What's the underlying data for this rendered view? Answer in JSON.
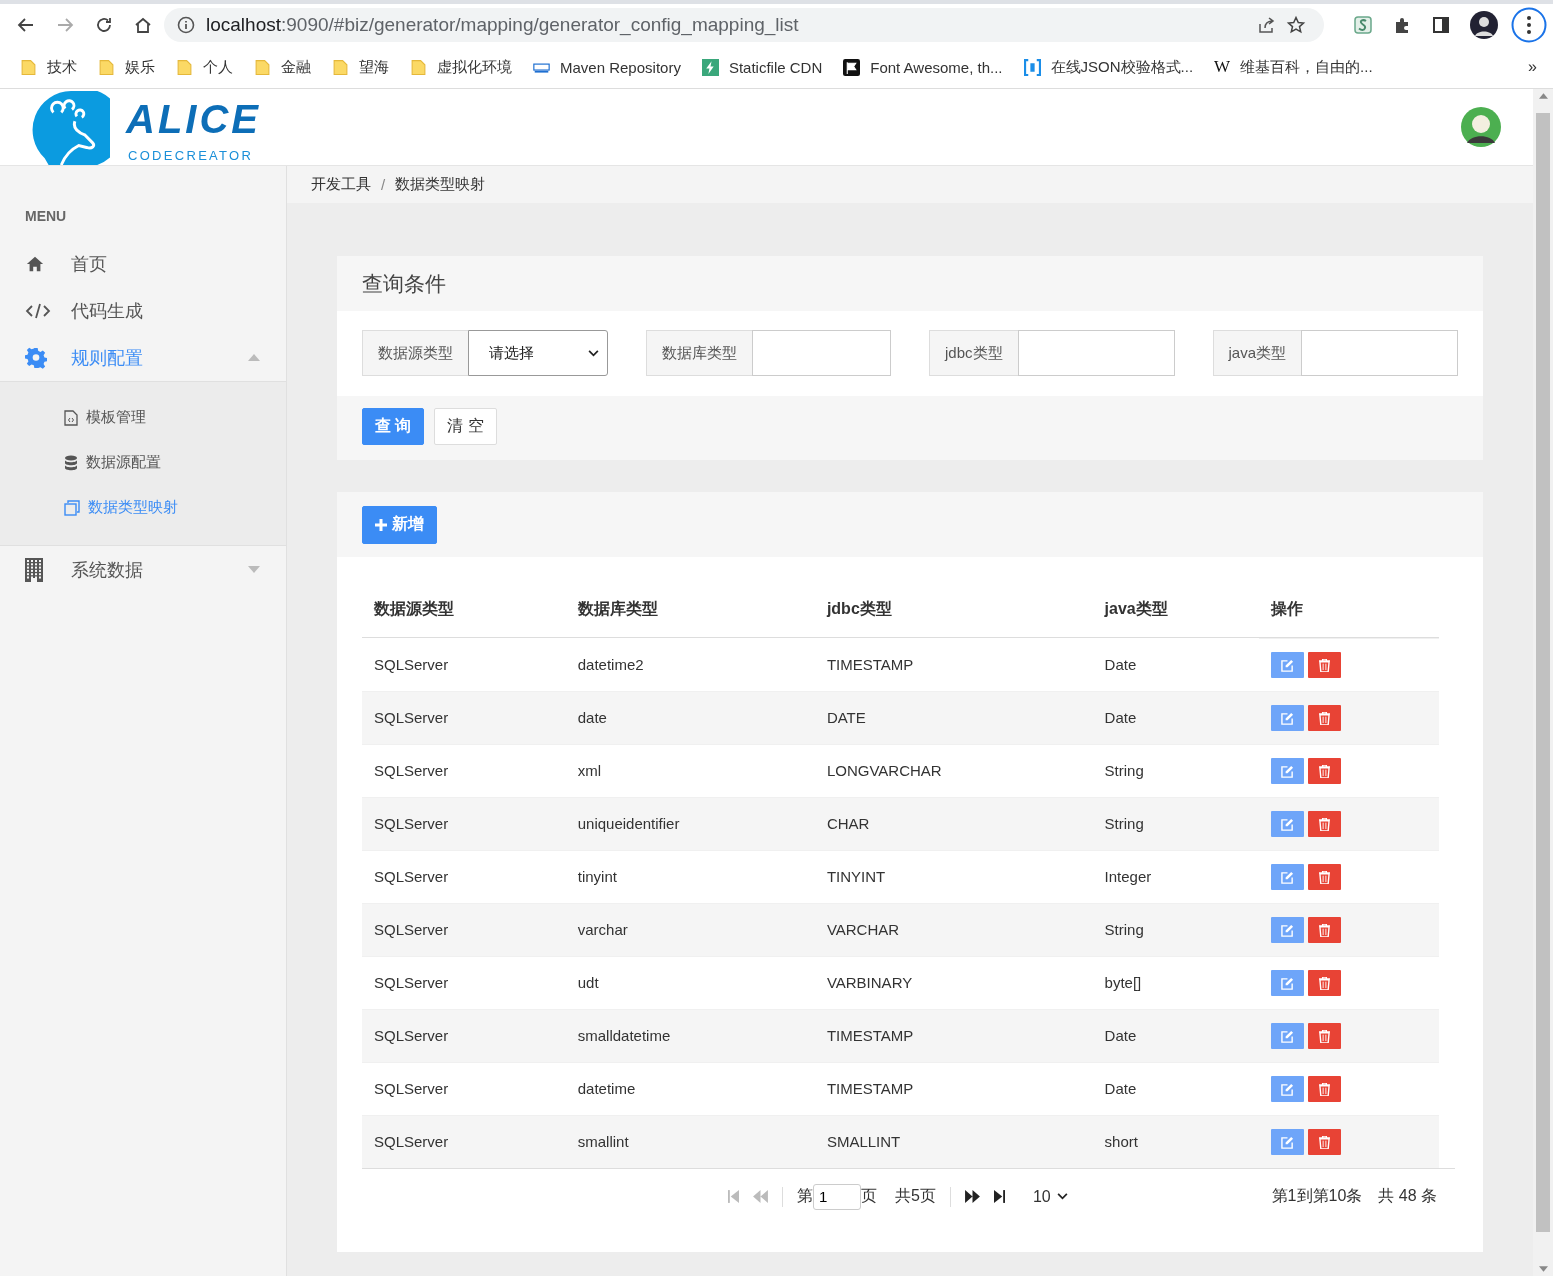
{
  "browser": {
    "address_host": "localhost",
    "address_rest": ":9090/#biz/generator/mapping/generator_config_mapping_list",
    "bookmarks": [
      {
        "label": "技术",
        "kind": "folder"
      },
      {
        "label": "娱乐",
        "kind": "folder"
      },
      {
        "label": "个人",
        "kind": "folder"
      },
      {
        "label": "金融",
        "kind": "folder"
      },
      {
        "label": "望海",
        "kind": "folder"
      },
      {
        "label": "虚拟化环境",
        "kind": "folder"
      },
      {
        "label": "Maven Repository",
        "kind": "maven"
      },
      {
        "label": "Staticfile CDN",
        "kind": "staticfile"
      },
      {
        "label": "Font Awesome, th...",
        "kind": "flag"
      },
      {
        "label": "在线JSON校验格式...",
        "kind": "bracket"
      },
      {
        "label": "维基百科，自由的...",
        "kind": "wiki",
        "icon_text": "W"
      }
    ],
    "overflow": "»"
  },
  "logo": {
    "title": "ALICE",
    "subtitle": "CODECREATOR"
  },
  "sidebar": {
    "heading": "MENU",
    "items": [
      {
        "label": "首页",
        "kind": "home",
        "selected": false
      },
      {
        "label": "代码生成",
        "kind": "code",
        "selected": false
      },
      {
        "label": "规则配置",
        "kind": "gear",
        "selected": true,
        "expanded": true,
        "children": [
          {
            "label": "模板管理",
            "kind": "file",
            "selected": false
          },
          {
            "label": "数据源配置",
            "kind": "database",
            "selected": false
          },
          {
            "label": "数据类型映射",
            "kind": "copy",
            "selected": true
          }
        ]
      },
      {
        "label": "系统数据",
        "kind": "building",
        "selected": false,
        "expanded": false
      }
    ]
  },
  "breadcrumb": [
    "开发工具",
    "数据类型映射"
  ],
  "breadcrumb_separator": "/",
  "query": {
    "title": "查询条件",
    "filters": [
      {
        "label": "数据源类型",
        "kind": "select",
        "value": "请选择"
      },
      {
        "label": "数据库类型",
        "kind": "text"
      },
      {
        "label": "jdbc类型",
        "kind": "text"
      },
      {
        "label": "java类型",
        "kind": "text"
      }
    ],
    "buttons": [
      {
        "label": "查 询",
        "kind": "primary"
      },
      {
        "label": "清 空",
        "kind": "default"
      }
    ]
  },
  "add_button": "新增",
  "table": {
    "columns": [
      "数据源类型",
      "数据库类型",
      "jdbc类型",
      "java类型",
      "操作"
    ],
    "rows": [
      [
        "SQLServer",
        "datetime2",
        "TIMESTAMP",
        "Date"
      ],
      [
        "SQLServer",
        "date",
        "DATE",
        "Date"
      ],
      [
        "SQLServer",
        "xml",
        "LONGVARCHAR",
        "String"
      ],
      [
        "SQLServer",
        "uniqueidentifier",
        "CHAR",
        "String"
      ],
      [
        "SQLServer",
        "tinyint",
        "TINYINT",
        "Integer"
      ],
      [
        "SQLServer",
        "varchar",
        "VARCHAR",
        "String"
      ],
      [
        "SQLServer",
        "udt",
        "VARBINARY",
        "byte[]"
      ],
      [
        "SQLServer",
        "smalldatetime",
        "TIMESTAMP",
        "Date"
      ],
      [
        "SQLServer",
        "datetime",
        "TIMESTAMP",
        "Date"
      ],
      [
        "SQLServer",
        "smallint",
        "SMALLINT",
        "short"
      ]
    ]
  },
  "pagination": {
    "page_prefix": "第",
    "page": "1",
    "page_suffix": "页",
    "total_pages": "共5页",
    "page_size": "10",
    "range": "第1到第10条",
    "total": "共 48 条"
  }
}
